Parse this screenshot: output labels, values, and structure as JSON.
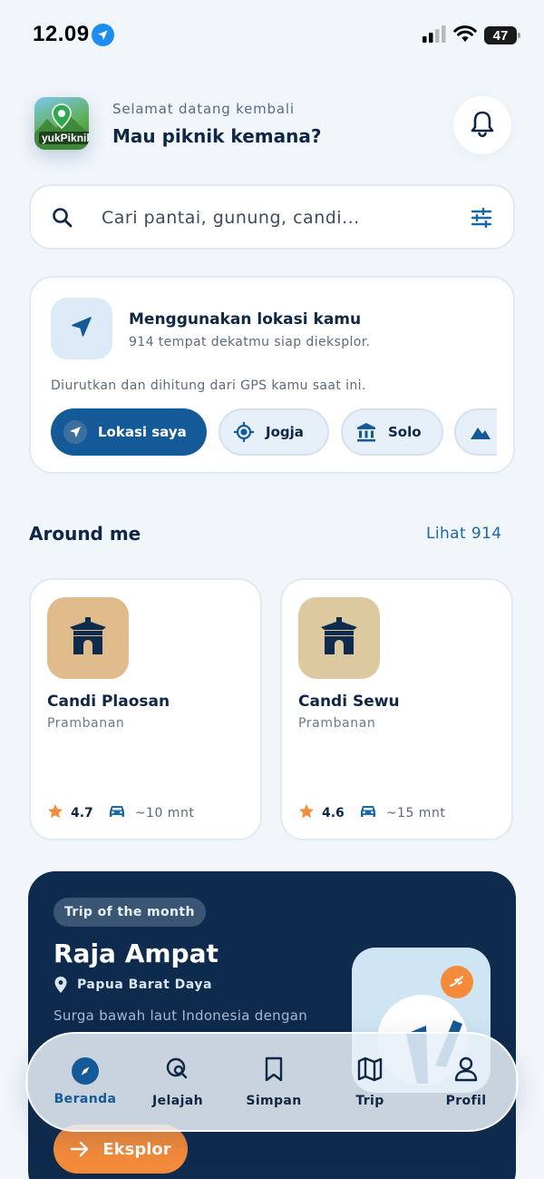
{
  "status_bar": {
    "time": "12.09",
    "battery": "47"
  },
  "header": {
    "logo_text": "yukPiknik",
    "welcome": "Selamat datang kembali",
    "headline": "Mau piknik kemana?"
  },
  "search": {
    "placeholder": "Cari pantai, gunung, candi..."
  },
  "location": {
    "title": "Menggunakan lokasi kamu",
    "subtitle": "914 tempat dekatmu siap dieksplor.",
    "note": "Diurutkan dan dihitung dari GPS kamu saat ini.",
    "chips": [
      {
        "label": "Lokasi saya",
        "icon": "navigation-arrow-icon",
        "active": true
      },
      {
        "label": "Jogja",
        "icon": "target-icon",
        "active": false
      },
      {
        "label": "Solo",
        "icon": "museum-icon",
        "active": false
      },
      {
        "label": "",
        "icon": "mountain-icon",
        "active": false
      }
    ]
  },
  "around_me": {
    "title": "Around me",
    "see_all": "Lihat 914",
    "places": [
      {
        "name": "Candi Plaosan",
        "area": "Prambanan",
        "rating": "4.7",
        "eta": "~10 mnt",
        "icon": "temple-icon",
        "thumb_color": "#e0bb8c"
      },
      {
        "name": "Candi Sewu",
        "area": "Prambanan",
        "rating": "4.6",
        "eta": "~15 mnt",
        "icon": "temple-icon",
        "thumb_color": "#dcc9a0"
      }
    ]
  },
  "trip_of_month": {
    "badge": "Trip of the month",
    "title": "Raja Ampat",
    "location": "Papua Barat Daya",
    "description": "Surga bawah laut Indonesia dengan",
    "cta": "Eksplor"
  },
  "nav": {
    "items": [
      {
        "label": "Beranda",
        "icon": "compass-icon",
        "active": true
      },
      {
        "label": "Jelajah",
        "icon": "search-map-icon",
        "active": false
      },
      {
        "label": "Simpan",
        "icon": "bookmark-icon",
        "active": false
      },
      {
        "label": "Trip",
        "icon": "map-icon",
        "active": false
      },
      {
        "label": "Profil",
        "icon": "user-icon",
        "active": false
      }
    ]
  },
  "colors": {
    "primary": "#155a98",
    "accent": "#f48b3a",
    "dark": "#0e2a4c",
    "background": "#f1f6fb"
  }
}
